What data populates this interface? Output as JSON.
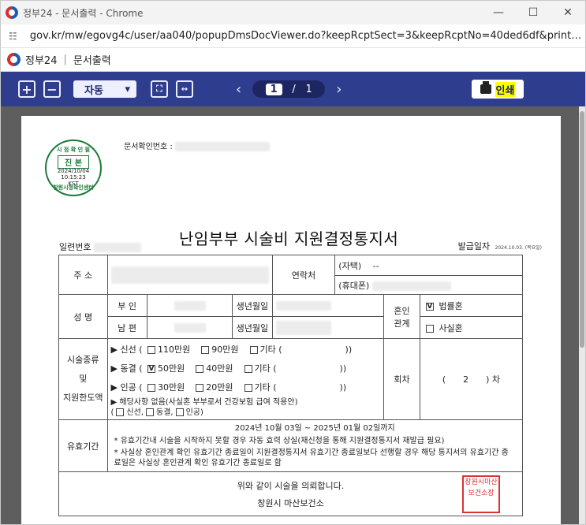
{
  "window": {
    "title": "정부24 - 문서출력 - Chrome",
    "url": "gov.kr/mw/egovg4c/user/aa040/popupDmsDocViewer.do?keepRcptSect=3&keepRcptNo=40ded6df&printAuth=Y&..."
  },
  "site": {
    "name": "정부24",
    "page": "문서출력"
  },
  "toolbar": {
    "zoom_in": "+",
    "zoom_out": "−",
    "zoom_value": "자동",
    "page_current": "1",
    "page_sep": "/",
    "page_total": "1",
    "print_label": "인쇄"
  },
  "seal": {
    "top_text": "시 점 확 인 필",
    "center_text": "진 본",
    "date": "2024/10/04",
    "time": "10:15:23",
    "tz": "KST",
    "bottom_text": "창원시청확인센터"
  },
  "doc": {
    "docno_label": "문서확인번호 :",
    "title": "난임부부 시술비 지원결정통지서",
    "issue_no_label": "일련번호",
    "issue_date_label": "발급일자",
    "issue_date_value": "2024.10.03. (목요일)",
    "address_label": "주 소",
    "contact_label": "연락처",
    "home_phone_label": "(자택)",
    "home_phone_value": "--",
    "mobile_label": "(휴대폰)",
    "name_label": "성 명",
    "husband_label": "부 인",
    "wife_label": "남 편",
    "dob_label": "생년월일",
    "marriage_label": "혼인\n관계",
    "marriage_legal": "법률혼",
    "marriage_defacto": "사실혼",
    "treatment_label_1": "시술종류",
    "treatment_label_2": "및",
    "treatment_label_3": "지원한도액",
    "opt1": "▶ 신선 ( ",
    "opt1_a": "110만원",
    "opt1_b": "90만원",
    "opt1_c": "기타 (",
    "opt_close": "))",
    "opt2": "▶ 동결 ( ",
    "opt2_a": "50만원",
    "opt2_b": "40만원",
    "opt3": "▶ 인공 ( ",
    "opt3_a": "30만원",
    "opt3_b": "20만원",
    "opt4": "▶ 해당사항 없음(사실혼 부부로서 건강보험 급여 적용안)",
    "opt4_sub_1": "신선,",
    "opt4_sub_2": "동결,",
    "opt4_sub_3": "인공)",
    "round_label": "회차",
    "round_value": "(　　2　　) 차",
    "validity_label": "유효기간",
    "validity_range": "2024년 10월 03일 ~ 2025년 01월 02일까지",
    "notice1": "* 유효기간내 시술을 시작하지 못할 경우 자동 효력 상실(재신청을 통해 지원결정통지서 재발급 필요)",
    "notice2": "* 사실상 혼인관계 확인 유효기간 종료일이 지원결정통지서 유효기간 종료일보다 선행할 경우 해당 통지서의 유효기간 종료일은 사실상 혼인관계 확인 유효기간 종료일로 함",
    "confirm_text": "위와 같이 시술을 의뢰합니다.",
    "issuer": "창원시 마산보건소",
    "stamp_text": "창원시마산보건소장"
  }
}
